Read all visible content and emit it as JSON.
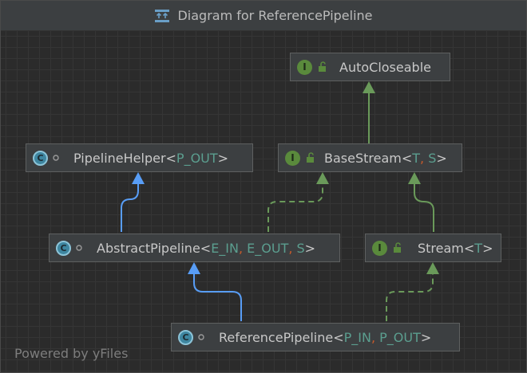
{
  "window": {
    "title": "Diagram for ReferencePipeline",
    "icon": "diagram-icon"
  },
  "footer": {
    "text": "Powered by yFiles"
  },
  "colors": {
    "background": "#2b2b2b",
    "node_fill": "#3c3f41",
    "interface_badge": "#5a8a3c",
    "class_badge": "#3e86a0",
    "extends_edge": "#589df6",
    "implements_edge": "#6a9a5a",
    "type_param": "#5b9e8f"
  },
  "nodes": {
    "autocloseable": {
      "kind": "I",
      "name": "AutoCloseable"
    },
    "basestream": {
      "kind": "I",
      "name": "BaseStream",
      "lt": "<",
      "p1": "T",
      "comma": ", ",
      "p2": "S",
      "gt": ">"
    },
    "pipelinehelper": {
      "kind": "C",
      "name": "PipelineHelper",
      "lt": "<",
      "p1": "P_OUT",
      "gt": ">"
    },
    "abstractpipeline": {
      "kind": "C",
      "name": "AbstractPipeline",
      "lt": "<",
      "p1": "E_IN",
      "comma1": ", ",
      "p2": "E_OUT",
      "comma2": ", ",
      "p3": "S",
      "gt": ">"
    },
    "stream": {
      "kind": "I",
      "name": "Stream",
      "lt": "<",
      "p1": "T",
      "gt": ">"
    },
    "referencepipeline": {
      "kind": "C",
      "name": "ReferencePipeline",
      "lt": "<",
      "p1": "P_IN",
      "comma": ", ",
      "p2": "P_OUT",
      "gt": ">"
    }
  },
  "edges": [
    {
      "from": "basestream",
      "to": "autocloseable",
      "type": "extends-interface"
    },
    {
      "from": "abstractpipeline",
      "to": "pipelinehelper",
      "type": "extends"
    },
    {
      "from": "abstractpipeline",
      "to": "basestream",
      "type": "implements"
    },
    {
      "from": "stream",
      "to": "basestream",
      "type": "extends-interface"
    },
    {
      "from": "referencepipeline",
      "to": "abstractpipeline",
      "type": "extends"
    },
    {
      "from": "referencepipeline",
      "to": "stream",
      "type": "implements"
    }
  ]
}
